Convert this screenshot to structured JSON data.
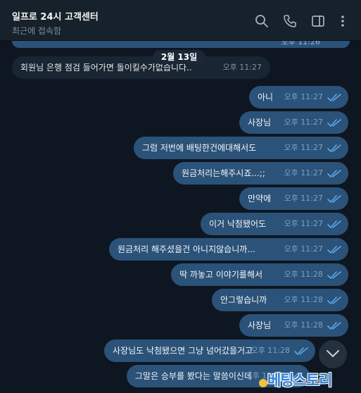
{
  "header": {
    "title": "일프로 24시 고객센터",
    "status": "최근에 접속함",
    "icons": [
      "search-icon",
      "phone-icon",
      "sidebar-icon",
      "more-icon"
    ]
  },
  "top_partial_time": "오후 11:26",
  "date_divider": "2월 13일",
  "messages": [
    {
      "text": "회원님 은행 점검 들어가면 돌이킬수가없습니다..",
      "time": "오후 11:27",
      "direction": "in"
    },
    {
      "text": "아니",
      "time": "오후 11:27",
      "direction": "out",
      "read": true
    },
    {
      "text": "사장님",
      "time": "오후 11:27",
      "direction": "out",
      "read": true
    },
    {
      "text": "그럼 저번에 배팅한건에대해서도",
      "time": "오후 11:27",
      "direction": "out",
      "read": true
    },
    {
      "text": "원금처리는해주시죠...;;",
      "time": "오후 11:27",
      "direction": "out",
      "read": true
    },
    {
      "text": "만약에",
      "time": "오후 11:27",
      "direction": "out",
      "read": true
    },
    {
      "text": "이거 낙첨됐어도",
      "time": "오후 11:27",
      "direction": "out",
      "read": true
    },
    {
      "text": "원금처리 해주셨을건 아니지않습니까...",
      "time": "오후 11:27",
      "direction": "out",
      "read": true
    },
    {
      "text": "딱 까놓고 이야기를해서",
      "time": "오후 11:28",
      "direction": "out",
      "read": true
    },
    {
      "text": "안그렇습니까",
      "time": "오후 11:28",
      "direction": "out",
      "read": true
    },
    {
      "text": "사장님",
      "time": "오후 11:28",
      "direction": "out",
      "read": true
    },
    {
      "text": "사장님도 낙첨됐으면 그냥 넘어갔을거고",
      "time": "오후 11:28",
      "direction": "out",
      "read": true
    },
    {
      "text": "그말은 승부를 봤다는 말씀이신데",
      "time": "오후 11:28",
      "direction": "out",
      "read": true
    }
  ],
  "watermark": "베팅스토리",
  "colors": {
    "background": "#0e1621",
    "header": "#17212b",
    "incoming_bubble": "#182533",
    "outgoing_bubble": "#2b5278",
    "read_check": "#5fa8e8"
  }
}
